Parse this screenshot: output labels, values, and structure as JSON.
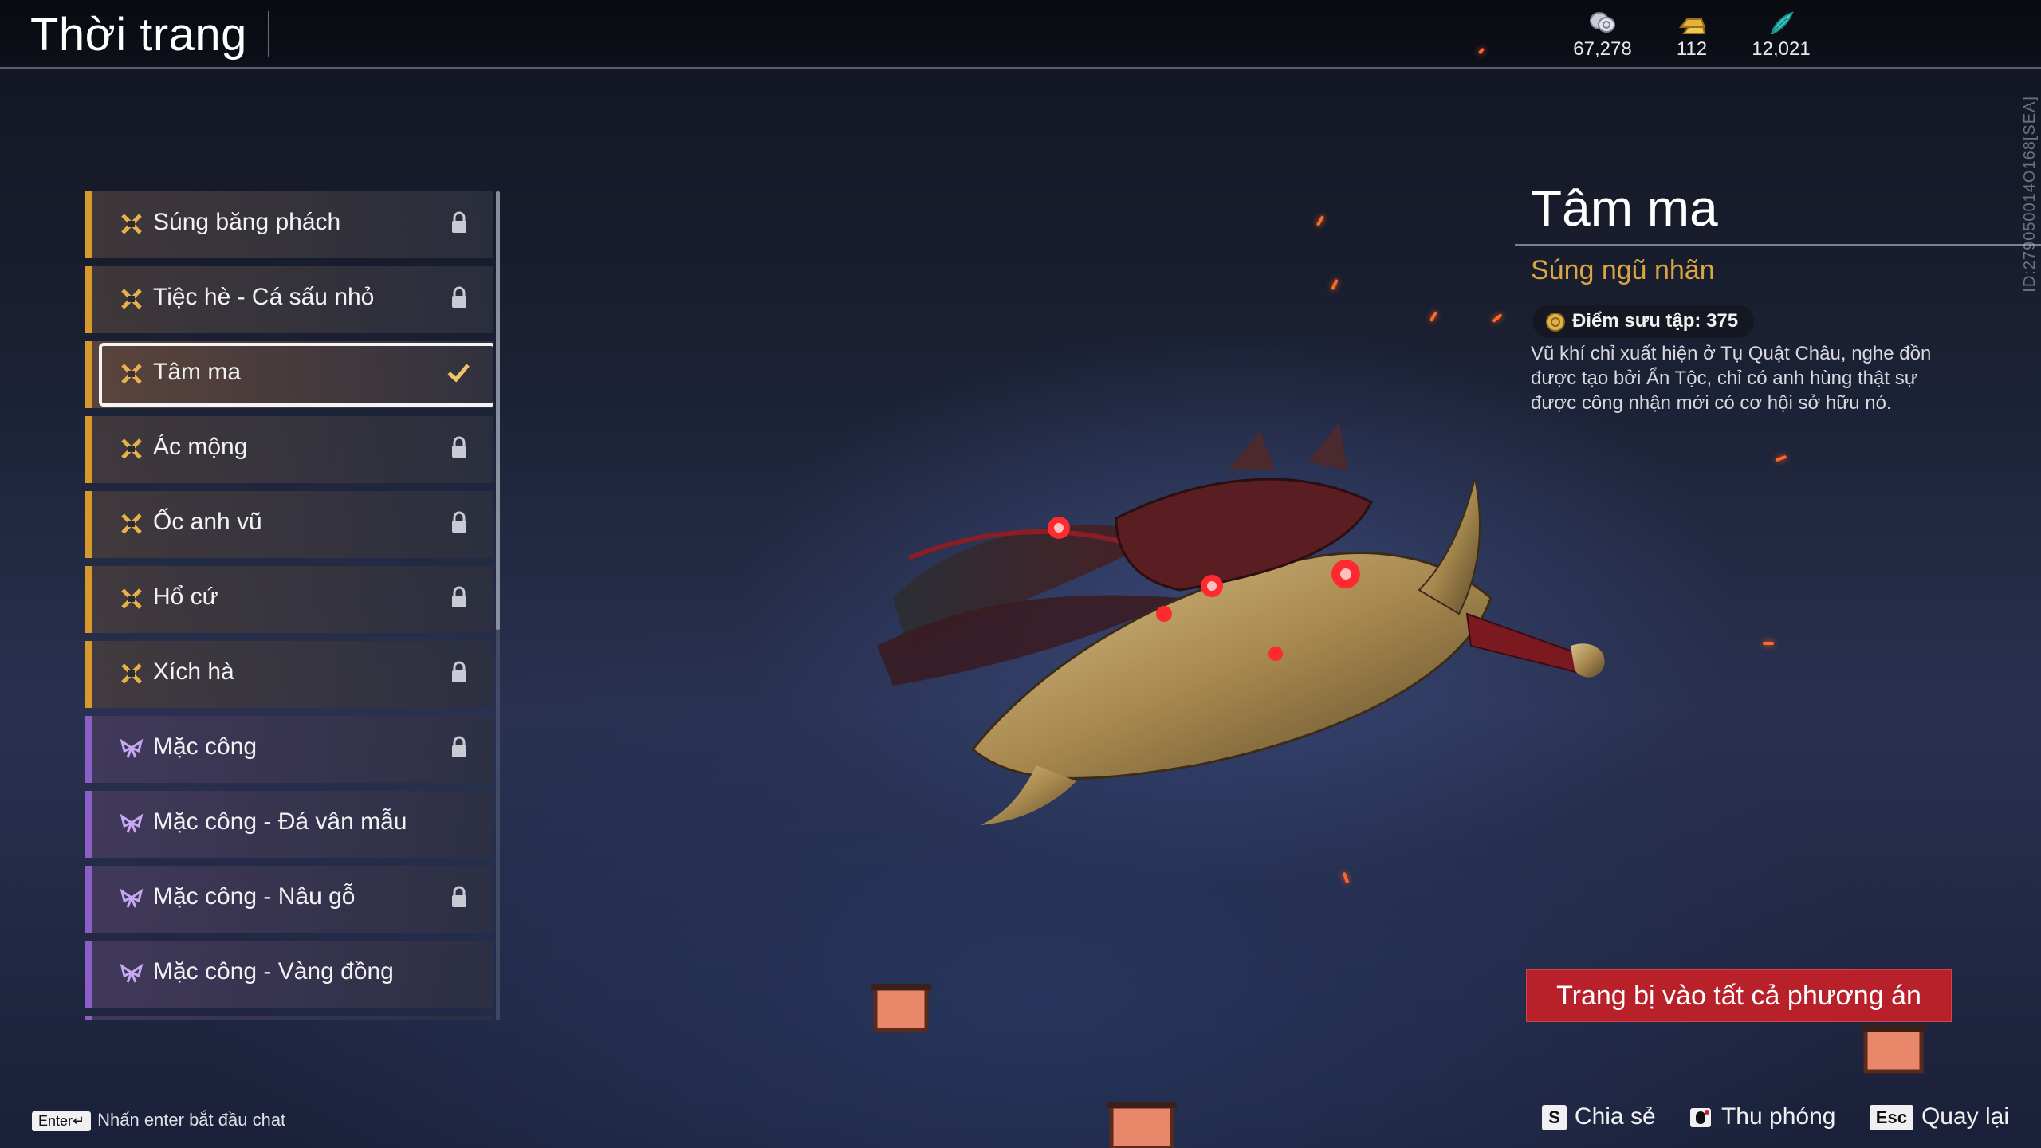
{
  "header": {
    "title": "Thời trang",
    "currencies": [
      {
        "icon": "coins-icon",
        "value": "67,278"
      },
      {
        "icon": "gold-bars-icon",
        "value": "112"
      },
      {
        "icon": "feather-icon",
        "value": "12,021"
      }
    ]
  },
  "side_id": "ID:279050014O168[SEA]",
  "list": {
    "items": [
      {
        "label": "Súng băng phách",
        "tier": "gold",
        "locked": true
      },
      {
        "label": "Tiệc hè - Cá sấu nhỏ",
        "tier": "gold",
        "locked": true
      },
      {
        "label": "Tâm ma",
        "tier": "gold",
        "locked": false,
        "selected": true
      },
      {
        "label": "Ác mộng",
        "tier": "gold",
        "locked": true
      },
      {
        "label": "Ốc anh vũ",
        "tier": "gold",
        "locked": true
      },
      {
        "label": "Hổ cứ",
        "tier": "gold",
        "locked": true
      },
      {
        "label": "Xích hà",
        "tier": "gold",
        "locked": true
      },
      {
        "label": "Mặc công",
        "tier": "purple",
        "locked": true
      },
      {
        "label": "Mặc công - Đá vân mẫu",
        "tier": "purple",
        "locked": false
      },
      {
        "label": "Mặc công - Nâu gỗ",
        "tier": "purple",
        "locked": true
      },
      {
        "label": "Mặc công - Vàng đồng",
        "tier": "purple",
        "locked": false
      }
    ]
  },
  "detail": {
    "title": "Tâm ma",
    "subtitle": "Súng ngũ nhãn",
    "points": "Điểm sưu tập: 375",
    "description": "Vũ khí chỉ xuất hiện ở Tụ Quật Châu, nghe đồn được tạo bởi Ẩn Tộc, chỉ có anh hùng thật sự được công nhận mới có cơ hội sở hữu nó.",
    "equip_button": "Trang bị vào tất cả phương án"
  },
  "footer": {
    "chat_key": "Enter↵",
    "chat_hint": "Nhấn enter bắt đầu chat",
    "actions": [
      {
        "key": "S",
        "label": "Chia sẻ"
      },
      {
        "key": "zoom-icon",
        "label": "Thu phóng"
      },
      {
        "key": "Esc",
        "label": "Quay lại"
      }
    ]
  },
  "colors": {
    "gold_tier": "#d7982c",
    "purple_tier": "#8b5fc6",
    "accent_red": "#b8202a",
    "subtitle_gold": "#d9a441"
  }
}
